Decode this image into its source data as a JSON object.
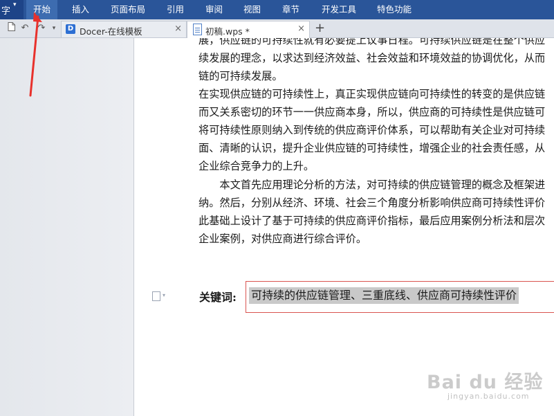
{
  "menubar": {
    "app_button": {
      "label": "字",
      "arrow": "▾"
    },
    "items": [
      {
        "label": "开始",
        "active": true
      },
      {
        "label": "插入"
      },
      {
        "label": "页面布局"
      },
      {
        "label": "引用"
      },
      {
        "label": "审阅"
      },
      {
        "label": "视图"
      },
      {
        "label": "章节"
      },
      {
        "label": "开发工具"
      },
      {
        "label": "特色功能"
      }
    ]
  },
  "quick_access": {
    "icons": [
      "new-document-icon",
      "undo-icon",
      "redo-icon",
      "dropdown-icon"
    ],
    "undo_glyph": "↶",
    "redo_glyph": "↷",
    "dropdown_glyph": "▾"
  },
  "tabs": [
    {
      "label": "Docer-在线模板",
      "icon": "docer-icon",
      "icon_text": "D",
      "close": "×"
    },
    {
      "label": "初稿.wps *",
      "icon": "wps-document-icon",
      "close": "×",
      "current": true
    }
  ],
  "new_tab_label": "+",
  "document": {
    "lines": [
      "展，供应链的可持续性就有必要提上议事日程。可持续供应链是在整个供应",
      "续发展的理念，以求达到经济效益、社会效益和环境效益的协调优化，从而",
      "链的可持续发展。",
      "在实现供应链的可持续性上，真正实现供应链向可持续性的转变的是供应链",
      "而又关系密切的环节一一供应商本身，所以，供应商的可持续性是供应链可",
      "将可持续性原则纳入到传统的供应商评价体系，可以帮助有关企业对可持续",
      "面、清晰的认识，提升企业供应链的可持续性，增强企业的社会责任感，从",
      "企业综合竞争力的上升。",
      "　　本文首先应用理论分析的方法，对可持续的供应链管理的概念及框架进",
      "纳。然后，分别从经济、环境、社会三个角度分析影响供应商可持续性评价",
      "此基础上设计了基于可持续的供应商评价指标，最后应用案例分析法和层次",
      "企业案例，对供应商进行综合评价。"
    ],
    "paragraph_arrow": "▾",
    "keywords_label": "关键词:",
    "keywords_text": "可持续的供应链管理、三重底线、供应商可持续性评价"
  },
  "watermark": {
    "logo": "Bai du 经验",
    "url": "jingyan.baidu.com"
  },
  "colors": {
    "menubar": "#2a5599",
    "active_menu": "#3d6cb0",
    "annotation": "#e8312c",
    "keyword_highlight": "#c9c9c9",
    "keyword_box": "#d9534f"
  }
}
